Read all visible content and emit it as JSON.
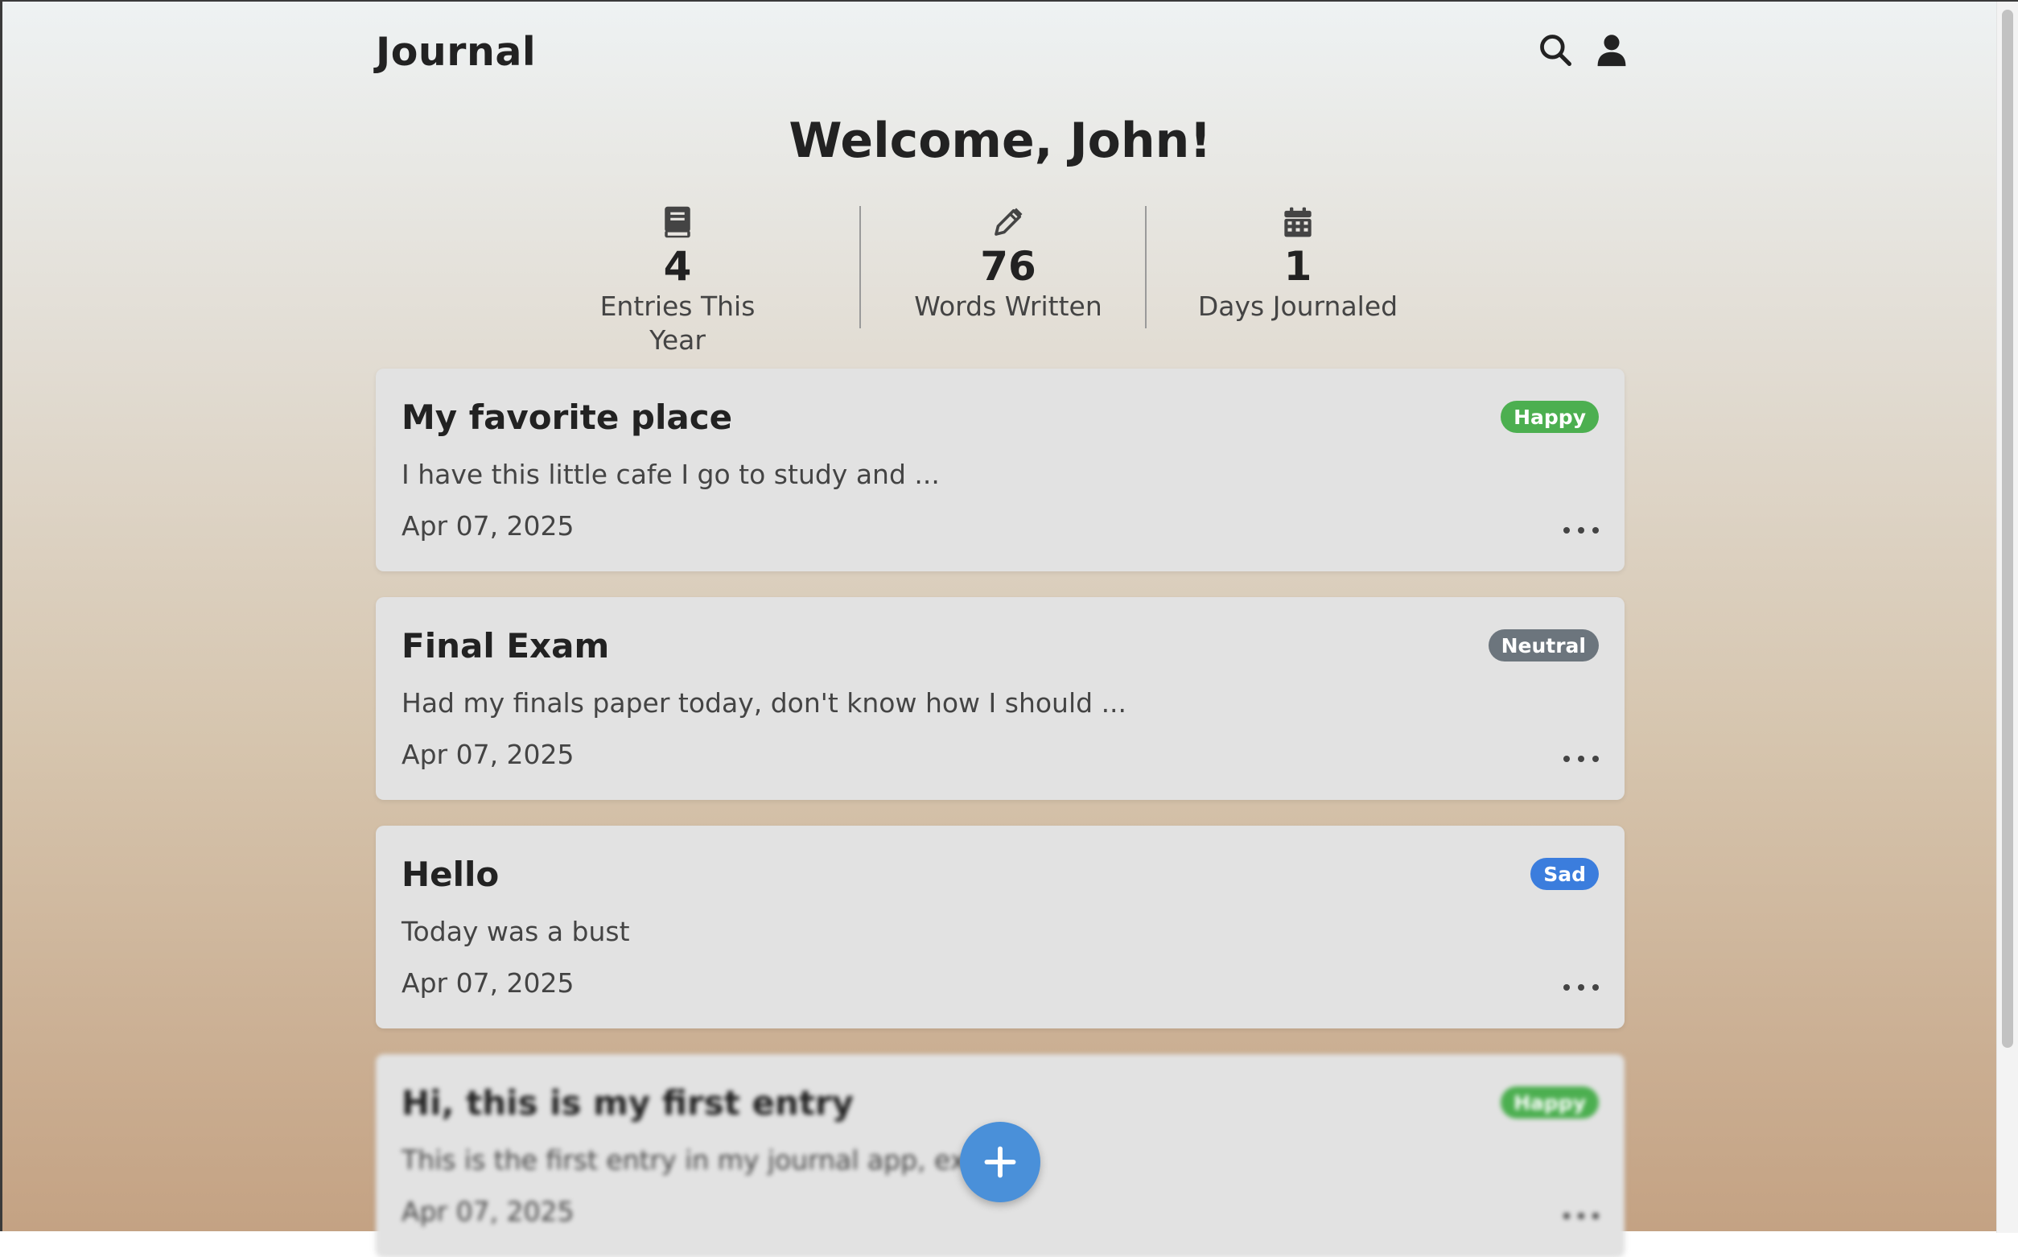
{
  "header": {
    "brand": "Journal",
    "search_icon": "search-icon",
    "profile_icon": "user-icon"
  },
  "welcome": "Welcome, John!",
  "stats": [
    {
      "icon": "book-icon",
      "value": "4",
      "label": "Entries This Year"
    },
    {
      "icon": "pencil-icon",
      "value": "76",
      "label": "Words Written"
    },
    {
      "icon": "calendar-icon",
      "value": "1",
      "label": "Days Journaled"
    }
  ],
  "entries": [
    {
      "title": "My favorite place",
      "preview": "I have this little cafe I go to study and ...",
      "date": "Apr 07, 2025",
      "mood": "Happy",
      "mood_color": "#4caf50"
    },
    {
      "title": "Final Exam",
      "preview": "Had my finals paper today, don't know how I should ...",
      "date": "Apr 07, 2025",
      "mood": "Neutral",
      "mood_color": "#6c757d"
    },
    {
      "title": "Hello",
      "preview": "Today was a bust",
      "date": "Apr 07, 2025",
      "mood": "Sad",
      "mood_color": "#3b7ddd"
    },
    {
      "title": "Hi, this is my first entry",
      "preview": "This is the first entry in my journal app, excit",
      "date": "Apr 07, 2025",
      "mood": "Happy",
      "mood_color": "#4caf50"
    }
  ],
  "fab_icon": "plus-icon",
  "colors": {
    "accent": "#4a90d9",
    "card_bg": "#e2e2e2"
  }
}
